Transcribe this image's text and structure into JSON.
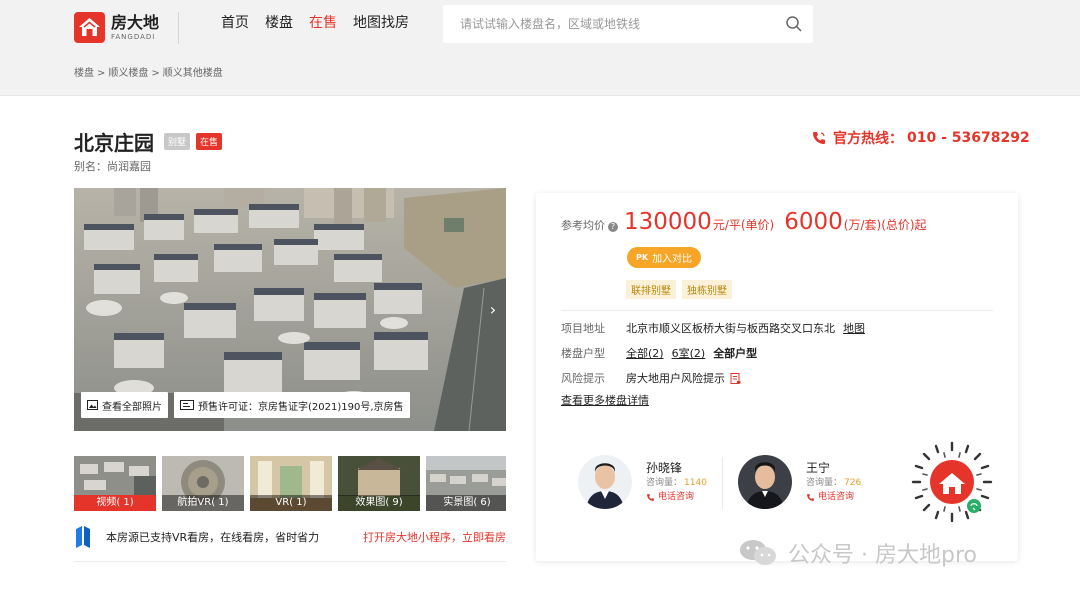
{
  "header": {
    "logo_cn": "房大地",
    "logo_en": "FANGDADI",
    "nav": [
      {
        "label": "首页",
        "active": false
      },
      {
        "label": "楼盘",
        "active": false
      },
      {
        "label": "在售",
        "active": true
      },
      {
        "label": "地图找房",
        "active": false
      }
    ],
    "search_placeholder": "请试试输入楼盘名，区域或地铁线"
  },
  "breadcrumb": {
    "items": [
      "楼盘",
      "顺义楼盘",
      "顺义其他楼盘"
    ],
    "separator": ">"
  },
  "property": {
    "name": "北京庄园",
    "tag_type": "别墅",
    "tag_status": "在售",
    "alias_label": "别名：",
    "alias_value": "尚润嘉园"
  },
  "hotline": {
    "label": "官方热线：",
    "number": "010 - 53678292"
  },
  "gallery": {
    "all_photos_label": "查看全部照片",
    "permit_text": "预售许可证：京房售证字(2021)190号,京房售",
    "thumbnails": [
      {
        "label": "视频( 1)",
        "active": true
      },
      {
        "label": "航拍VR( 1)",
        "active": false
      },
      {
        "label": "VR( 1)",
        "active": false
      },
      {
        "label": "效果图( 9)",
        "active": false
      },
      {
        "label": "实景图( 6)",
        "active": false
      }
    ],
    "vr_notice": "本房源已支持VR看房，在线看房，省时省力",
    "vr_link": "打开房大地小程序，立即看房"
  },
  "pricing": {
    "label": "参考均价",
    "unit_price": "130000",
    "unit_price_suffix": "元/平(单价)",
    "total_price": "6000",
    "total_price_suffix": "(万/套)(总价)起",
    "compare_prefix": "PK",
    "compare_label": "加入对比",
    "feature_tags": [
      "联排别墅",
      "独栋别墅"
    ]
  },
  "details": {
    "address_label": "项目地址",
    "address_value": "北京市顺义区板桥大街与板西路交叉口东北",
    "map_link": "地图",
    "layout_label": "楼盘户型",
    "layout_all": "全部(2)",
    "layout_6room": "6室(2)",
    "layout_all_types": "全部户型",
    "risk_label": "风险提示",
    "risk_value": "房大地用户风险提示",
    "more_link": "查看更多楼盘详情"
  },
  "agents": [
    {
      "name": "孙晓锋",
      "views_label": "咨询量：",
      "views": "1140",
      "call_label": "电话咨询"
    },
    {
      "name": "王宁",
      "views_label": "咨询量：",
      "views": "726",
      "call_label": "电话咨询"
    }
  ],
  "watermark": "公众号 · 房大地pro",
  "colors": {
    "accent": "#e5352b",
    "orange": "#f7a526",
    "header_bg": "#f2f2f2"
  }
}
